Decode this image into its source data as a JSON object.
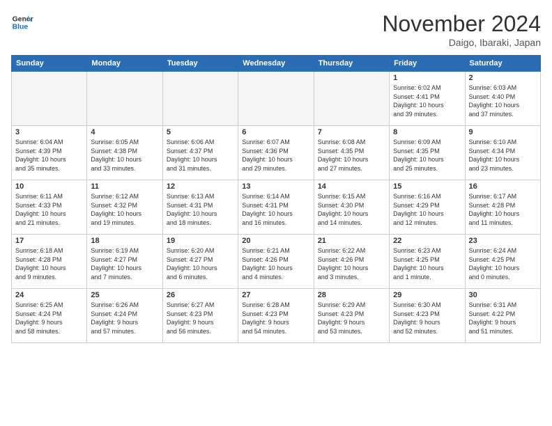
{
  "header": {
    "logo_line1": "General",
    "logo_line2": "Blue",
    "month": "November 2024",
    "location": "Daigo, Ibaraki, Japan"
  },
  "weekdays": [
    "Sunday",
    "Monday",
    "Tuesday",
    "Wednesday",
    "Thursday",
    "Friday",
    "Saturday"
  ],
  "weeks": [
    [
      {
        "day": "",
        "info": ""
      },
      {
        "day": "",
        "info": ""
      },
      {
        "day": "",
        "info": ""
      },
      {
        "day": "",
        "info": ""
      },
      {
        "day": "",
        "info": ""
      },
      {
        "day": "1",
        "info": "Sunrise: 6:02 AM\nSunset: 4:41 PM\nDaylight: 10 hours\nand 39 minutes."
      },
      {
        "day": "2",
        "info": "Sunrise: 6:03 AM\nSunset: 4:40 PM\nDaylight: 10 hours\nand 37 minutes."
      }
    ],
    [
      {
        "day": "3",
        "info": "Sunrise: 6:04 AM\nSunset: 4:39 PM\nDaylight: 10 hours\nand 35 minutes."
      },
      {
        "day": "4",
        "info": "Sunrise: 6:05 AM\nSunset: 4:38 PM\nDaylight: 10 hours\nand 33 minutes."
      },
      {
        "day": "5",
        "info": "Sunrise: 6:06 AM\nSunset: 4:37 PM\nDaylight: 10 hours\nand 31 minutes."
      },
      {
        "day": "6",
        "info": "Sunrise: 6:07 AM\nSunset: 4:36 PM\nDaylight: 10 hours\nand 29 minutes."
      },
      {
        "day": "7",
        "info": "Sunrise: 6:08 AM\nSunset: 4:35 PM\nDaylight: 10 hours\nand 27 minutes."
      },
      {
        "day": "8",
        "info": "Sunrise: 6:09 AM\nSunset: 4:35 PM\nDaylight: 10 hours\nand 25 minutes."
      },
      {
        "day": "9",
        "info": "Sunrise: 6:10 AM\nSunset: 4:34 PM\nDaylight: 10 hours\nand 23 minutes."
      }
    ],
    [
      {
        "day": "10",
        "info": "Sunrise: 6:11 AM\nSunset: 4:33 PM\nDaylight: 10 hours\nand 21 minutes."
      },
      {
        "day": "11",
        "info": "Sunrise: 6:12 AM\nSunset: 4:32 PM\nDaylight: 10 hours\nand 19 minutes."
      },
      {
        "day": "12",
        "info": "Sunrise: 6:13 AM\nSunset: 4:31 PM\nDaylight: 10 hours\nand 18 minutes."
      },
      {
        "day": "13",
        "info": "Sunrise: 6:14 AM\nSunset: 4:31 PM\nDaylight: 10 hours\nand 16 minutes."
      },
      {
        "day": "14",
        "info": "Sunrise: 6:15 AM\nSunset: 4:30 PM\nDaylight: 10 hours\nand 14 minutes."
      },
      {
        "day": "15",
        "info": "Sunrise: 6:16 AM\nSunset: 4:29 PM\nDaylight: 10 hours\nand 12 minutes."
      },
      {
        "day": "16",
        "info": "Sunrise: 6:17 AM\nSunset: 4:28 PM\nDaylight: 10 hours\nand 11 minutes."
      }
    ],
    [
      {
        "day": "17",
        "info": "Sunrise: 6:18 AM\nSunset: 4:28 PM\nDaylight: 10 hours\nand 9 minutes."
      },
      {
        "day": "18",
        "info": "Sunrise: 6:19 AM\nSunset: 4:27 PM\nDaylight: 10 hours\nand 7 minutes."
      },
      {
        "day": "19",
        "info": "Sunrise: 6:20 AM\nSunset: 4:27 PM\nDaylight: 10 hours\nand 6 minutes."
      },
      {
        "day": "20",
        "info": "Sunrise: 6:21 AM\nSunset: 4:26 PM\nDaylight: 10 hours\nand 4 minutes."
      },
      {
        "day": "21",
        "info": "Sunrise: 6:22 AM\nSunset: 4:26 PM\nDaylight: 10 hours\nand 3 minutes."
      },
      {
        "day": "22",
        "info": "Sunrise: 6:23 AM\nSunset: 4:25 PM\nDaylight: 10 hours\nand 1 minute."
      },
      {
        "day": "23",
        "info": "Sunrise: 6:24 AM\nSunset: 4:25 PM\nDaylight: 10 hours\nand 0 minutes."
      }
    ],
    [
      {
        "day": "24",
        "info": "Sunrise: 6:25 AM\nSunset: 4:24 PM\nDaylight: 9 hours\nand 58 minutes."
      },
      {
        "day": "25",
        "info": "Sunrise: 6:26 AM\nSunset: 4:24 PM\nDaylight: 9 hours\nand 57 minutes."
      },
      {
        "day": "26",
        "info": "Sunrise: 6:27 AM\nSunset: 4:23 PM\nDaylight: 9 hours\nand 56 minutes."
      },
      {
        "day": "27",
        "info": "Sunrise: 6:28 AM\nSunset: 4:23 PM\nDaylight: 9 hours\nand 54 minutes."
      },
      {
        "day": "28",
        "info": "Sunrise: 6:29 AM\nSunset: 4:23 PM\nDaylight: 9 hours\nand 53 minutes."
      },
      {
        "day": "29",
        "info": "Sunrise: 6:30 AM\nSunset: 4:23 PM\nDaylight: 9 hours\nand 52 minutes."
      },
      {
        "day": "30",
        "info": "Sunrise: 6:31 AM\nSunset: 4:22 PM\nDaylight: 9 hours\nand 51 minutes."
      }
    ]
  ]
}
